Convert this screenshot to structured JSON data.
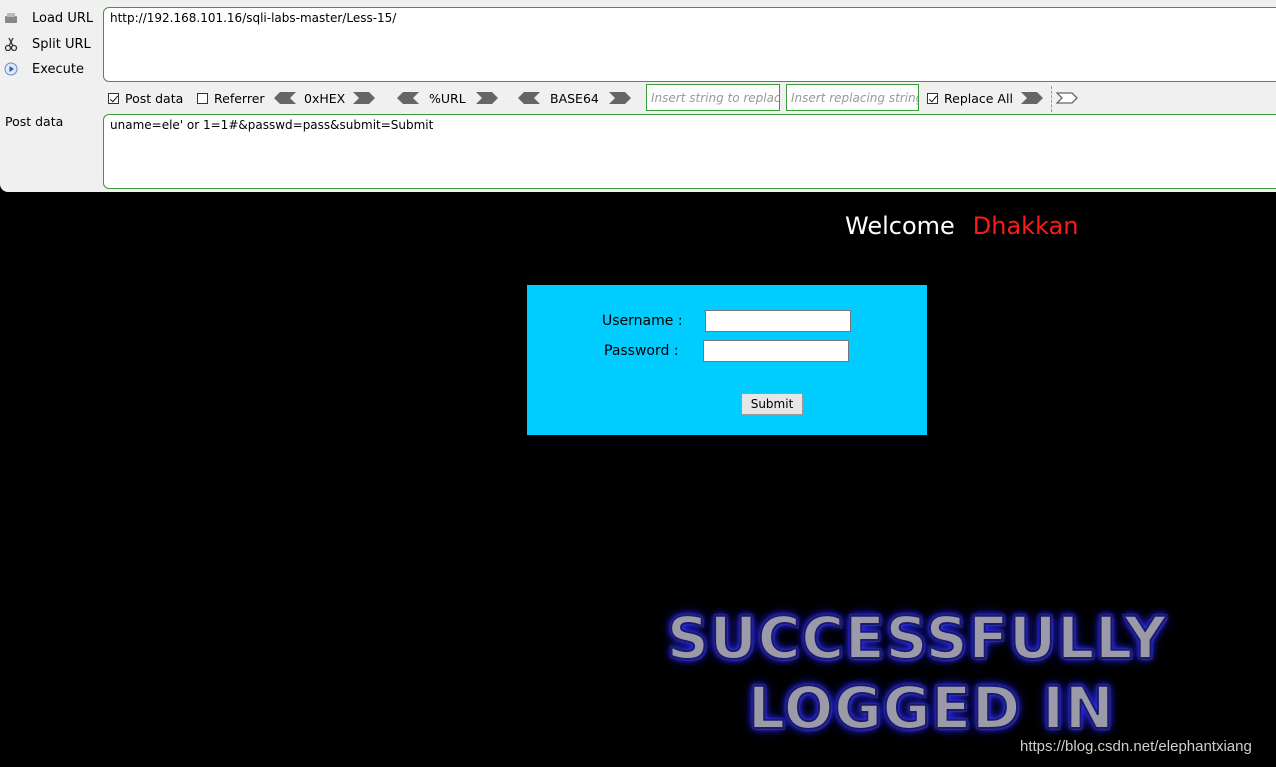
{
  "hackbar": {
    "buttons": {
      "load_url": "Load URL",
      "split_url": "Split URL",
      "execute": "Execute"
    },
    "url_value": "http://192.168.101.16/sqli-labs-master/Less-15/",
    "options": {
      "post_data": {
        "label": "Post data",
        "checked": true
      },
      "referrer": {
        "label": "Referrer",
        "checked": false
      },
      "hex": "0xHEX",
      "url_enc": "%URL",
      "base64": "BASE64",
      "replace_from_placeholder": "Insert string to replace",
      "replace_to_placeholder": "Insert replacing string",
      "replace_all": {
        "label": "Replace All",
        "checked": true
      }
    },
    "post_label": "Post data",
    "post_value": "uname=ele' or 1=1#&passwd=pass&submit=Submit"
  },
  "page": {
    "welcome": "Welcome",
    "user": "Dhakkan",
    "form": {
      "username_label": "Username :",
      "password_label": "Password :",
      "submit_label": "Submit"
    },
    "banner_line1": "SUCCESSFULLY",
    "banner_line2": "LOGGED IN",
    "watermark": "https://blog.csdn.net/elephantxiang"
  },
  "colors": {
    "form_bg": "#00ccff",
    "user_name": "#ff1a1a",
    "border_green": "#3a9a3a"
  }
}
